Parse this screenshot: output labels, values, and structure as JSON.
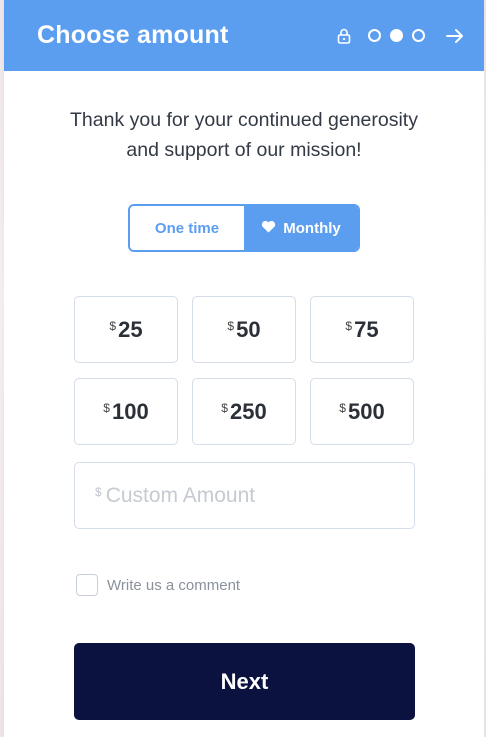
{
  "header": {
    "title": "Choose amount",
    "icons": [
      "lock-icon",
      "step-dot-empty",
      "step-dot-filled",
      "step-dot-empty",
      "arrow-right-icon"
    ]
  },
  "message": {
    "line1": "Thank you for your continued generosity",
    "line2": "and support of our mission!"
  },
  "frequency": {
    "one_time": "One time",
    "monthly": "Monthly",
    "selected": "Monthly"
  },
  "amounts": [
    {
      "currency": "$",
      "value": "25"
    },
    {
      "currency": "$",
      "value": "50"
    },
    {
      "currency": "$",
      "value": "75"
    },
    {
      "currency": "$",
      "value": "100"
    },
    {
      "currency": "$",
      "value": "250"
    },
    {
      "currency": "$",
      "value": "500"
    }
  ],
  "custom_amount": {
    "currency": "$",
    "placeholder": "Custom Amount"
  },
  "comment": {
    "label": "Write us a comment",
    "checked": false
  },
  "next_button": {
    "label": "Next"
  },
  "colors": {
    "accent": "#5b9ef0",
    "button_dark": "#0b1240",
    "border": "#d5dde8"
  }
}
